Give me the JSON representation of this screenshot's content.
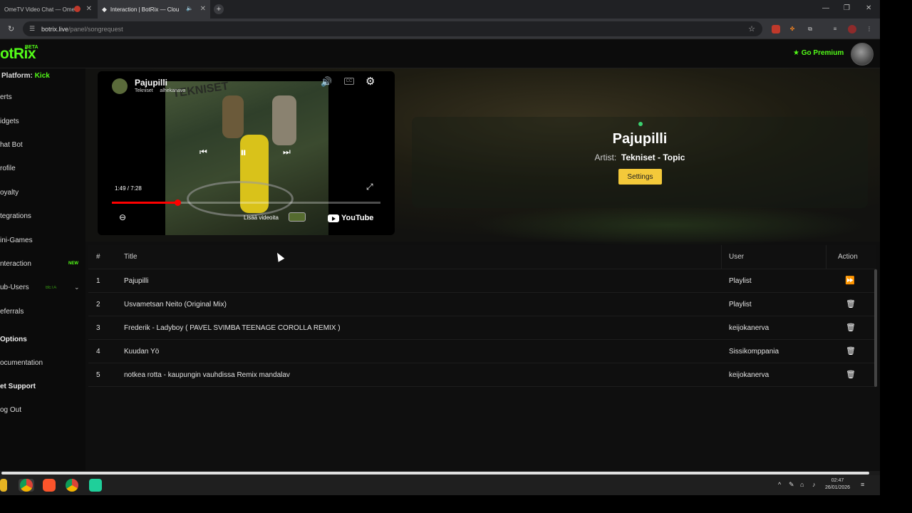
{
  "browser": {
    "tabs": [
      {
        "title": "OmeTV Video Chat — Ome",
        "active": false
      },
      {
        "title": "Interaction | BotRix — Clou",
        "active": true
      }
    ],
    "url_host": "botrix.live",
    "url_path": "/panel/songrequest"
  },
  "header": {
    "logo": "otRix",
    "beta": "BETA",
    "premium": "Go Premium"
  },
  "sidebar": {
    "platform_label": "Platform:",
    "platform_value": "Kick",
    "items": [
      {
        "label": "erts"
      },
      {
        "label": "idgets"
      },
      {
        "label": "hat Bot"
      },
      {
        "label": "rofile"
      },
      {
        "label": "oyalty"
      },
      {
        "label": "tegrations"
      },
      {
        "label": "ini-Games"
      },
      {
        "label": "nteraction",
        "badge": "NEW"
      },
      {
        "label": "ub-Users",
        "badge": "BETA"
      },
      {
        "label": "eferrals"
      },
      {
        "label": "Options"
      },
      {
        "label": "ocumentation"
      },
      {
        "label": "et Support"
      },
      {
        "label": "og Out"
      }
    ]
  },
  "player": {
    "video_title": "Pajupilli",
    "channel": "Tekniset",
    "channel_extra": "alhekanava",
    "thumbnail_text": "TEKNISET",
    "time": "1:49 / 7:28",
    "progress": 0.245,
    "more_videos": "Lisää videoita",
    "youtube": "YouTube"
  },
  "now_playing": {
    "title": "Pajupilli",
    "artist_label": "Artist:",
    "artist": "Tekniset - Topic",
    "settings": "Settings"
  },
  "queue": {
    "headers": [
      "#",
      "Title",
      "User",
      "Action"
    ],
    "rows": [
      {
        "num": "1",
        "title": "Pajupilli",
        "user": "Playlist",
        "action": "skip"
      },
      {
        "num": "2",
        "title": "Usvametsan Neito (Original Mix)",
        "user": "Playlist",
        "action": "delete"
      },
      {
        "num": "3",
        "title": "Frederik - Ladyboy ( PAVEL SVIMBA TEENAGE COROLLA REMIX )",
        "user": "keijokanerva",
        "action": "delete"
      },
      {
        "num": "4",
        "title": "Kuudan Yö",
        "user": "Sissikomppania",
        "action": "delete"
      },
      {
        "num": "5",
        "title": "notkea rotta - kaupungin vauhdissa Remix mandalav",
        "user": "keijokanerva",
        "action": "delete"
      }
    ]
  },
  "taskbar": {
    "clock_time": "02:47",
    "clock_date": "26/01/2026"
  },
  "colors": {
    "accent": "#53fc18",
    "settings_button": "#f4c93a",
    "progress": "#ff0000"
  }
}
